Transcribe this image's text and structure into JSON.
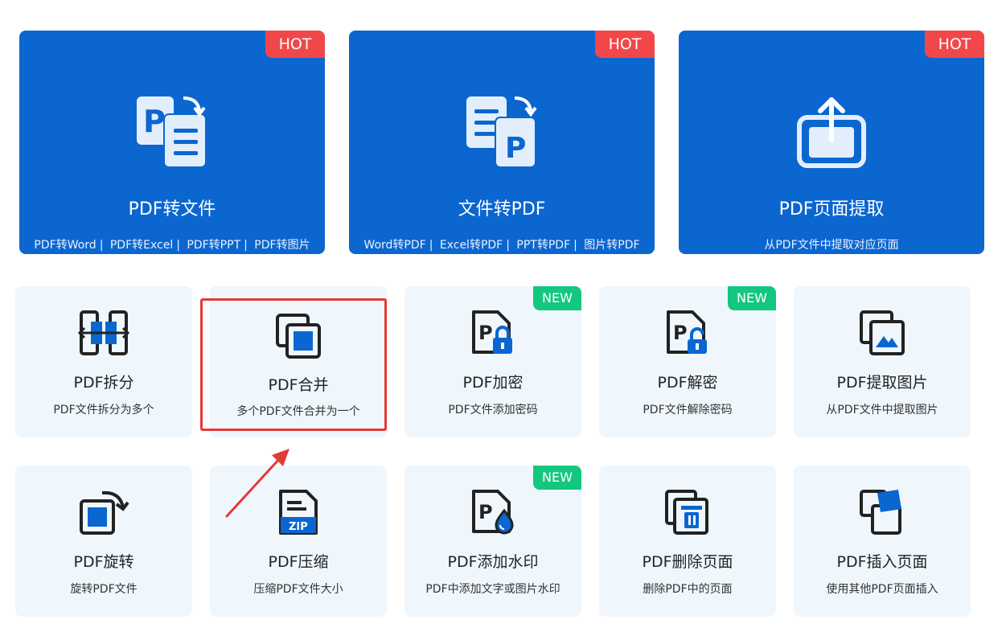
{
  "colors": {
    "primary": "#0b66d0",
    "hot": "#f2474a",
    "new": "#14c77f",
    "card_bg": "#eff7fd",
    "highlight": "#e53935"
  },
  "featured": [
    {
      "title": "PDF转文件",
      "badge": "HOT",
      "icon": "pdf-to-file-icon",
      "links": [
        "PDF转Word",
        "PDF转Excel",
        "PDF转PPT",
        "PDF转图片"
      ]
    },
    {
      "title": "文件转PDF",
      "badge": "HOT",
      "icon": "file-to-pdf-icon",
      "links": [
        "Word转PDF",
        "Excel转PDF",
        "PPT转PDF",
        "图片转PDF"
      ]
    },
    {
      "title": "PDF页面提取",
      "badge": "HOT",
      "icon": "extract-page-icon",
      "desc": "从PDF文件中提取对应页面"
    }
  ],
  "tools": [
    {
      "title": "PDF拆分",
      "desc": "PDF文件拆分为多个",
      "icon": "split-icon"
    },
    {
      "title": "PDF合并",
      "desc": "多个PDF文件合并为一个",
      "icon": "merge-icon"
    },
    {
      "title": "PDF加密",
      "desc": "PDF文件添加密码",
      "icon": "lock-icon",
      "badge": "NEW"
    },
    {
      "title": "PDF解密",
      "desc": "PDF文件解除密码",
      "icon": "unlock-icon",
      "badge": "NEW"
    },
    {
      "title": "PDF提取图片",
      "desc": "从PDF文件中提取图片",
      "icon": "image-icon"
    },
    {
      "title": "PDF旋转",
      "desc": "旋转PDF文件",
      "icon": "rotate-icon"
    },
    {
      "title": "PDF压缩",
      "desc": "压缩PDF文件大小",
      "icon": "zip-icon",
      "icon_text": "ZIP"
    },
    {
      "title": "PDF添加水印",
      "desc": "PDF中添加文字或图片水印",
      "icon": "watermark-icon",
      "badge": "NEW"
    },
    {
      "title": "PDF删除页面",
      "desc": "删除PDF中的页面",
      "icon": "delete-page-icon"
    },
    {
      "title": "PDF插入页面",
      "desc": "使用其他PDF页面插入",
      "icon": "insert-page-icon"
    }
  ],
  "annotation": {
    "highlight_target": "PDF合并"
  }
}
